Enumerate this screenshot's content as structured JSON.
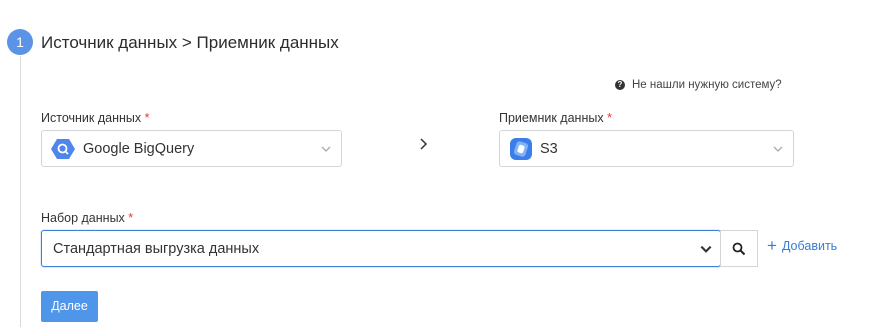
{
  "step": {
    "number": "1",
    "title": "Источник данных > Приемник данных"
  },
  "help_link": "Не нашли нужную систему?",
  "source": {
    "label": "Источник данных",
    "required_mark": "*",
    "value": "Google BigQuery",
    "icon": "google-bigquery-icon"
  },
  "destination": {
    "label": "Приемник данных",
    "required_mark": "*",
    "value": "S3",
    "icon": "s3-icon"
  },
  "dataset": {
    "label": "Набор данных",
    "required_mark": "*",
    "value": "Стандартная выгрузка данных"
  },
  "add_link": "Добавить",
  "next_button": "Далее",
  "colors": {
    "accent": "#4f95ea",
    "focus_border": "#3b82d6",
    "required": "#e53935",
    "link": "#3a7bd5"
  }
}
